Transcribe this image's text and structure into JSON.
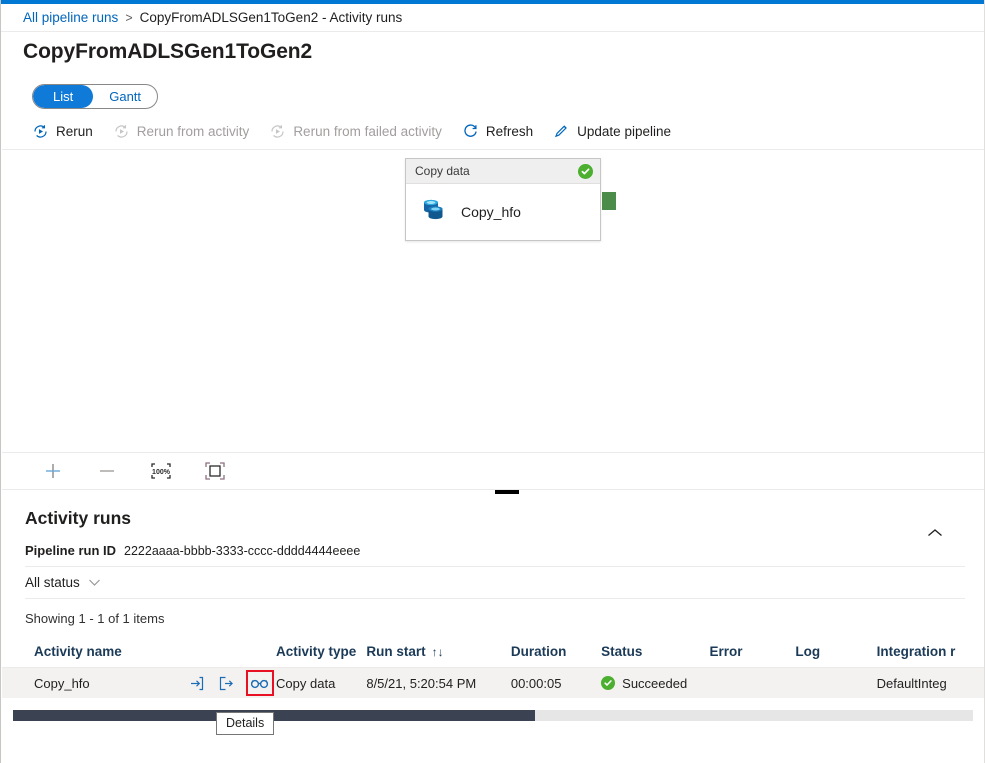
{
  "theme": {
    "accent": "#0078d4",
    "link": "#0066bb",
    "success_green": "#4caf2f",
    "connector_green": "#4c8c4a",
    "highlight_red": "#e81123",
    "scrollbar_thumb": "#3b4252",
    "row_bg": "#f3f2f1"
  },
  "breadcrumb": {
    "root": "All pipeline runs",
    "separator": ">",
    "current": "CopyFromADLSGen1ToGen2 - Activity runs"
  },
  "header": {
    "title": "CopyFromADLSGen1ToGen2"
  },
  "view_toggle": {
    "options": [
      {
        "label": "List",
        "selected": true
      },
      {
        "label": "Gantt",
        "selected": false
      }
    ]
  },
  "command_bar": {
    "items": [
      {
        "label": "Rerun",
        "icon": "rerun-icon",
        "disabled": false
      },
      {
        "label": "Rerun from activity",
        "icon": "rerun-from-activity-icon",
        "disabled": true
      },
      {
        "label": "Rerun from failed activity",
        "icon": "rerun-from-failed-activity-icon",
        "disabled": true
      },
      {
        "label": "Refresh",
        "icon": "refresh-icon",
        "disabled": false
      },
      {
        "label": "Update pipeline",
        "icon": "pencil-icon",
        "disabled": false
      }
    ]
  },
  "canvas": {
    "node": {
      "header_label": "Copy data",
      "status_icon": "success-check-icon",
      "activity_name": "Copy_hfo",
      "activity_icon": "copy-data-icon"
    },
    "zoom_controls": [
      {
        "name": "zoom-in-icon",
        "label": "+"
      },
      {
        "name": "zoom-out-icon",
        "label": "—"
      },
      {
        "name": "zoom-to-100-icon",
        "label": "100%"
      },
      {
        "name": "fit-to-screen-icon",
        "label": ""
      }
    ]
  },
  "activity_runs": {
    "title": "Activity runs",
    "collapse_icon": "chevron-up-icon",
    "pipeline_run_id_label": "Pipeline run ID",
    "pipeline_run_id_value": "2222aaaa-bbbb-3333-cccc-dddd4444eeee",
    "status_filter": {
      "label": "All status",
      "chevron": "chevron-down-icon"
    },
    "showing_text": "Showing 1 - 1 of 1 items",
    "columns": [
      "Activity name",
      "",
      "Activity type",
      "Run start",
      "Duration",
      "Status",
      "Error",
      "Log",
      "Integration r"
    ],
    "sort_indicator": "↑↓",
    "rows": [
      {
        "activity_name": "Copy_hfo",
        "actions": [
          {
            "name": "input-icon",
            "highlighted": false
          },
          {
            "name": "output-icon",
            "highlighted": false
          },
          {
            "name": "details-glasses-icon",
            "highlighted": true
          }
        ],
        "activity_type": "Copy data",
        "run_start": "8/5/21, 5:20:54 PM",
        "duration": "00:00:05",
        "status": "Succeeded",
        "status_icon": "success-check-icon",
        "error": "",
        "log": "",
        "integration_runtime": "DefaultInteg"
      }
    ]
  },
  "tooltip": {
    "text": "Details"
  }
}
